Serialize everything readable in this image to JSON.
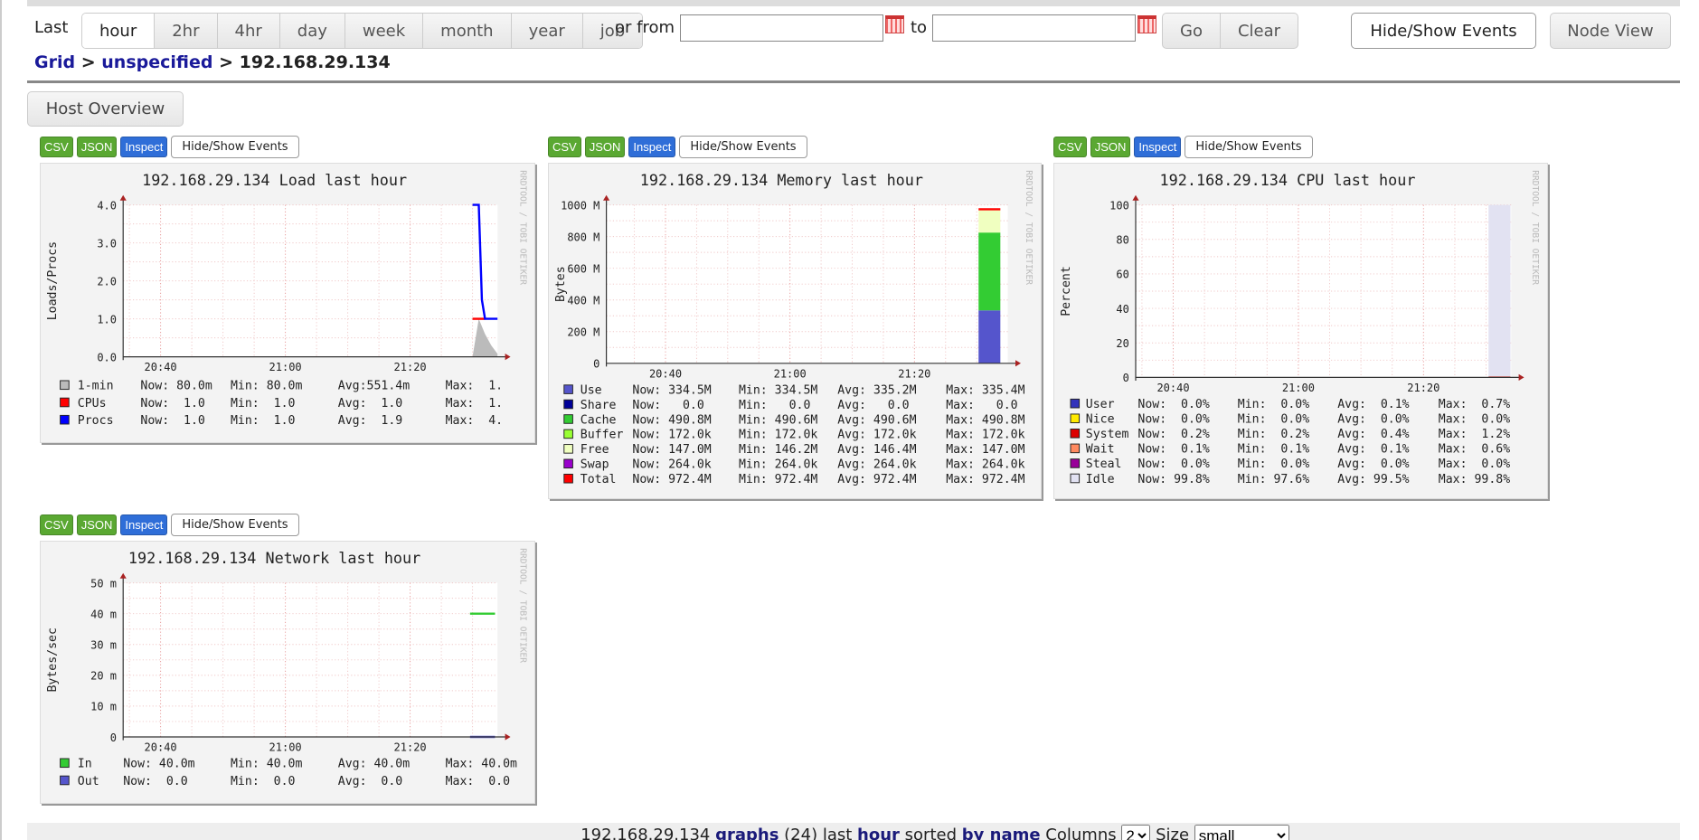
{
  "toolbar": {
    "last_label": "Last",
    "ranges": [
      "hour",
      "2hr",
      "4hr",
      "day",
      "week",
      "month",
      "year",
      "job"
    ],
    "active_range": "hour",
    "or_from_label": "or from",
    "from_value": "",
    "to_label": "to",
    "to_value": "",
    "go_label": "Go",
    "clear_label": "Clear",
    "hide_show_events_label": "Hide/Show Events",
    "node_view_label": "Node View"
  },
  "breadcrumb": {
    "grid": "Grid",
    "sep": ">",
    "cluster": "unspecified",
    "host": "192.168.29.134"
  },
  "host_overview_label": "Host Overview",
  "graph_buttons": {
    "csv": "CSV",
    "json": "JSON",
    "inspect": "Inspect",
    "events": "Hide/Show Events"
  },
  "watermark": "RRDTOOL / TOBI OETIKER",
  "colors": {
    "link": "#1a1a9a",
    "csv": "#5aa832",
    "inspect": "#2f6ed8"
  },
  "chart_data": [
    {
      "type": "line",
      "title": "192.168.29.134 Load last hour",
      "ylabel": "Loads/Procs",
      "ylim": [
        0,
        4
      ],
      "yticks": [
        0,
        1,
        2,
        3,
        4
      ],
      "ytick_labels": [
        "0.0",
        "1.0",
        "2.0",
        "3.0",
        "4.0"
      ],
      "xlim": [
        "20:34",
        "21:34"
      ],
      "xticks": [
        "20:40",
        "21:00",
        "21:20"
      ],
      "grid": true,
      "series": [
        {
          "name": "1-min",
          "color": "#bbbbbb",
          "kind": "area",
          "points": [
            [
              "21:30",
              0
            ],
            [
              "21:31",
              1.0
            ],
            [
              "21:32",
              0.6
            ],
            [
              "21:33",
              0.3
            ],
            [
              "21:34",
              0.08
            ]
          ],
          "now": "Now: 80.0m",
          "min": "Min: 80.0m",
          "avg": "Avg:551.4m",
          "max": "Max:  1."
        },
        {
          "name": "CPUs",
          "color": "#ff0000",
          "kind": "line",
          "points": [
            [
              "21:30",
              1.0
            ],
            [
              "21:32",
              1.0
            ]
          ],
          "now": "Now:  1.0",
          "min": "Min:  1.0",
          "avg": "Avg:  1.0",
          "max": "Max:  1."
        },
        {
          "name": "Procs",
          "color": "#0000ff",
          "kind": "line",
          "points": [
            [
              "21:30",
              4.0
            ],
            [
              "21:31",
              4.0
            ],
            [
              "21:31.5",
              1.5
            ],
            [
              "21:32",
              1.0
            ],
            [
              "21:34",
              1.0
            ]
          ],
          "now": "Now:  1.0",
          "min": "Min:  1.0",
          "avg": "Avg:  1.9",
          "max": "Max:  4."
        }
      ]
    },
    {
      "type": "area",
      "title": "192.168.29.134 Memory last hour",
      "ylabel": "Bytes",
      "ylim": [
        0,
        1000
      ],
      "yticks": [
        0,
        200,
        400,
        600,
        800,
        1000
      ],
      "ytick_labels": [
        "0",
        "200 M",
        "400 M",
        "600 M",
        "800 M",
        "1000 M"
      ],
      "xlim": [
        "20:30.5",
        "21:35"
      ],
      "xticks": [
        "20:40",
        "21:00",
        "21:20"
      ],
      "grid": true,
      "series": [
        {
          "name": "Use",
          "color": "#5555cc",
          "kind": "stack",
          "points": [
            [
              "21:30.3",
              334.5
            ],
            [
              "21:33.8",
              334.5
            ]
          ],
          "now": "Now: 334.5M",
          "min": "Min: 334.5M",
          "avg": "Avg: 335.2M",
          "max": "Max: 335.4M"
        },
        {
          "name": "Share",
          "color": "#000099",
          "kind": "stack",
          "points": [
            [
              "21:30.3",
              0
            ],
            [
              "21:33.8",
              0
            ]
          ],
          "now": "Now:   0.0",
          "min": "Min:   0.0",
          "avg": "Avg:   0.0",
          "max": "Max:   0.0"
        },
        {
          "name": "Cache",
          "color": "#33cc33",
          "kind": "stack",
          "points": [
            [
              "21:30.3",
              490.8
            ],
            [
              "21:33.8",
              490.8
            ]
          ],
          "now": "Now: 490.8M",
          "min": "Min: 490.6M",
          "avg": "Avg: 490.6M",
          "max": "Max: 490.8M"
        },
        {
          "name": "Buffer",
          "color": "#99ff33",
          "kind": "stack",
          "points": [
            [
              "21:30.3",
              0.172
            ],
            [
              "21:33.8",
              0.172
            ]
          ],
          "now": "Now: 172.0k",
          "min": "Min: 172.0k",
          "avg": "Avg: 172.0k",
          "max": "Max: 172.0k"
        },
        {
          "name": "Free",
          "color": "#f0ffc0",
          "kind": "stack",
          "points": [
            [
              "21:30.3",
              147.0
            ],
            [
              "21:33.8",
              147.0
            ]
          ],
          "now": "Now: 147.0M",
          "min": "Min: 146.2M",
          "avg": "Avg: 146.4M",
          "max": "Max: 147.0M"
        },
        {
          "name": "Swap",
          "color": "#9900cc",
          "kind": "stack",
          "points": [
            [
              "21:30.3",
              0.264
            ],
            [
              "21:33.8",
              0.264
            ]
          ],
          "now": "Now: 264.0k",
          "min": "Min: 264.0k",
          "avg": "Avg: 264.0k",
          "max": "Max: 264.0k"
        },
        {
          "name": "Total",
          "color": "#ff0000",
          "kind": "line",
          "points": [
            [
              "21:30.3",
              972.4
            ],
            [
              "21:33.8",
              972.4
            ]
          ],
          "now": "Now: 972.4M",
          "min": "Min: 972.4M",
          "avg": "Avg: 972.4M",
          "max": "Max: 972.4M"
        }
      ]
    },
    {
      "type": "area",
      "title": "192.168.29.134 CPU last hour",
      "ylabel": "Percent",
      "ylim": [
        0,
        100
      ],
      "yticks": [
        0,
        20,
        40,
        60,
        80,
        100
      ],
      "ytick_labels": [
        "0",
        "20",
        "40",
        "60",
        "80",
        "100"
      ],
      "xlim": [
        "20:34",
        "21:34"
      ],
      "xticks": [
        "20:40",
        "21:00",
        "21:20"
      ],
      "grid": true,
      "series": [
        {
          "name": "User",
          "color": "#3333bb",
          "kind": "stack",
          "points": [
            [
              "21:30.4",
              0.1
            ],
            [
              "21:33.9",
              0.1
            ]
          ],
          "now": "Now:  0.0%",
          "min": "Min:  0.0%",
          "avg": "Avg:  0.1%",
          "max": "Max:  0.7%"
        },
        {
          "name": "Nice",
          "color": "#ffea00",
          "kind": "stack",
          "points": [
            [
              "21:30.4",
              0
            ],
            [
              "21:33.9",
              0
            ]
          ],
          "now": "Now:  0.0%",
          "min": "Min:  0.0%",
          "avg": "Avg:  0.0%",
          "max": "Max:  0.0%"
        },
        {
          "name": "System",
          "color": "#dd0000",
          "kind": "stack",
          "points": [
            [
              "21:30.4",
              0.4
            ],
            [
              "21:33.9",
              0.4
            ]
          ],
          "now": "Now:  0.2%",
          "min": "Min:  0.2%",
          "avg": "Avg:  0.4%",
          "max": "Max:  1.2%"
        },
        {
          "name": "Wait",
          "color": "#ff8a60",
          "kind": "stack",
          "points": [
            [
              "21:30.4",
              0.1
            ],
            [
              "21:33.9",
              0.1
            ]
          ],
          "now": "Now:  0.1%",
          "min": "Min:  0.1%",
          "avg": "Avg:  0.1%",
          "max": "Max:  0.6%"
        },
        {
          "name": "Steal",
          "color": "#990099",
          "kind": "stack",
          "points": [
            [
              "21:30.4",
              0
            ],
            [
              "21:33.9",
              0
            ]
          ],
          "now": "Now:  0.0%",
          "min": "Min:  0.0%",
          "avg": "Avg:  0.0%",
          "max": "Max:  0.0%"
        },
        {
          "name": "Idle",
          "color": "#e2e2f2",
          "kind": "stack",
          "points": [
            [
              "21:30.4",
              99.4
            ],
            [
              "21:33.9",
              99.4
            ]
          ],
          "now": "Now: 99.8%",
          "min": "Min: 97.6%",
          "avg": "Avg: 99.5%",
          "max": "Max: 99.8%"
        }
      ]
    },
    {
      "type": "line",
      "title": "192.168.29.134 Network last hour",
      "ylabel": "Bytes/sec",
      "ylim": [
        0,
        50
      ],
      "yticks": [
        0,
        10,
        20,
        30,
        40,
        50
      ],
      "ytick_labels": [
        "0",
        "10 m",
        "20 m",
        "30 m",
        "40 m",
        "50 m"
      ],
      "xlim": [
        "20:34",
        "21:34"
      ],
      "xticks": [
        "20:40",
        "21:00",
        "21:20"
      ],
      "grid": true,
      "series": [
        {
          "name": "In",
          "color": "#33cc33",
          "kind": "line",
          "points": [
            [
              "21:29.6",
              40
            ],
            [
              "21:33.6",
              40
            ]
          ],
          "now": "Now: 40.0m",
          "min": "Min: 40.0m",
          "avg": "Avg: 40.0m",
          "max": "Max: 40.0m"
        },
        {
          "name": "Out",
          "color": "#5555cc",
          "kind": "line",
          "points": [
            [
              "21:29.6",
              0
            ],
            [
              "21:33.6",
              0
            ]
          ],
          "now": "Now:  0.0",
          "min": "Min:  0.0",
          "avg": "Avg:  0.0",
          "max": "Max:  0.0"
        }
      ]
    }
  ],
  "footer": {
    "host": "192.168.29.134",
    "graphs_link": "graphs",
    "count": "(24)",
    "last": "last",
    "range_link": "hour",
    "sorted": "sorted",
    "by_name_link": "by name",
    "columns_label": "Columns",
    "columns_value": "2",
    "size_label": "Size",
    "size_value": "small"
  }
}
